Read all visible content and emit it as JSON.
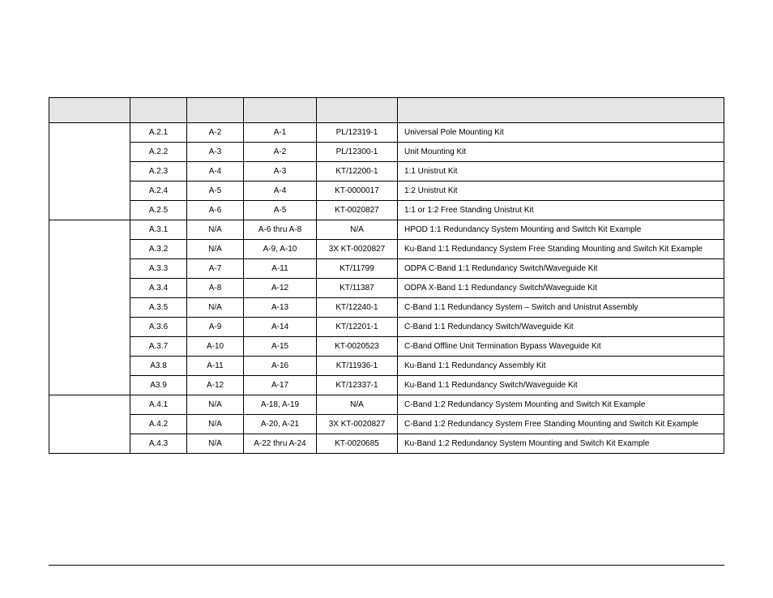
{
  "table": {
    "columns": [
      "",
      "",
      "",
      "",
      "",
      ""
    ],
    "groups": [
      {
        "label": "",
        "rows": [
          [
            "A.2.1",
            "A-2",
            "A-1",
            "PL/12319-1",
            "Universal Pole Mounting Kit"
          ],
          [
            "A.2.2",
            "A-3",
            "A-2",
            "PL/12300-1",
            "Unit Mounting Kit"
          ],
          [
            "A.2.3",
            "A-4",
            "A-3",
            "KT/12200-1",
            "1:1 Unistrut Kit"
          ],
          [
            "A.2.4",
            "A-5",
            "A-4",
            "KT-0000017",
            "1:2 Unistrut Kit"
          ],
          [
            "A.2.5",
            "A-6",
            "A-5",
            "KT-0020827",
            "1:1 or 1:2 Free Standing Unistrut Kit"
          ]
        ]
      },
      {
        "label": "",
        "rows": [
          [
            "A.3.1",
            "N/A",
            "A-6 thru A-8",
            "N/A",
            "HPOD 1:1 Redundancy System Mounting and Switch Kit Example"
          ],
          [
            "A.3.2",
            "N/A",
            "A-9, A-10",
            "3X KT-0020827",
            "Ku-Band 1:1 Redundancy System Free Standing Mounting and Switch Kit Example"
          ],
          [
            "A.3.3",
            "A-7",
            "A-11",
            "KT/11799",
            "ODPA C-Band 1:1 Redundancy Switch/Waveguide Kit"
          ],
          [
            "A.3.4",
            "A-8",
            "A-12",
            "KT/11387",
            "ODPA X-Band 1:1 Redundancy Switch/Waveguide Kit"
          ],
          [
            "A.3.5",
            "N/A",
            "A-13",
            "KT/12240-1",
            "C-Band 1:1 Redundancy System – Switch and Unistrut Assembly"
          ],
          [
            "A.3.6",
            "A-9",
            "A-14",
            "KT/12201-1",
            "C-Band 1:1 Redundancy Switch/Waveguide Kit"
          ],
          [
            "A.3.7",
            "A-10",
            "A-15",
            "KT-0020523",
            "C-Band Offline Unit Termination Bypass Waveguide Kit"
          ],
          [
            "A3.8",
            "A-11",
            "A-16",
            "KT/11936-1",
            "Ku-Band 1:1 Redundancy Assembly Kit"
          ],
          [
            "A3.9",
            "A-12",
            "A-17",
            "KT/12337-1",
            "Ku-Band 1:1 Redundancy Switch/Waveguide Kit"
          ]
        ]
      },
      {
        "label": "",
        "rows": [
          [
            "A.4.1",
            "N/A",
            "A-18, A-19",
            "N/A",
            "C-Band 1:2 Redundancy System Mounting and Switch Kit Example"
          ],
          [
            "A.4.2",
            "N/A",
            "A-20, A-21",
            "3X KT-0020827",
            "C-Band 1:2 Redundancy System Free Standing Mounting and Switch Kit Example"
          ],
          [
            "A.4.3",
            "N/A",
            "A-22 thru A-24",
            "KT-0020685",
            "Ku-Band 1:2 Redundancy System Mounting and Switch Kit Example"
          ]
        ]
      }
    ]
  }
}
